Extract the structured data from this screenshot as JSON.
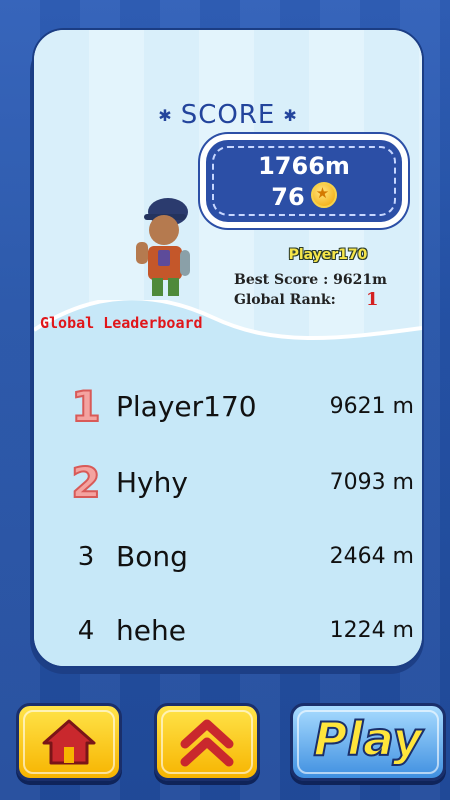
{
  "score_panel": {
    "title": "SCORE",
    "distance": "1766m",
    "coins": "76",
    "player_name": "Player170",
    "best_score": "Best Score : 9621m",
    "global_rank_label": "Global Rank:",
    "global_rank_value": "1"
  },
  "leaderboard": {
    "title": "Global Leaderboard",
    "entries": [
      {
        "rank": "1",
        "name": "Player170",
        "distance": "9621 m"
      },
      {
        "rank": "2",
        "name": "Hyhy",
        "distance": "7093 m"
      },
      {
        "rank": "3",
        "name": "Bong",
        "distance": "2464 m"
      },
      {
        "rank": "4",
        "name": "hehe",
        "distance": "1224 m"
      }
    ]
  },
  "buttons": {
    "home_icon": "home-icon",
    "up_icon": "double-chevron-up-icon",
    "play_label": "Play"
  },
  "colors": {
    "background": "#2553a8",
    "panel": "#dff1fb",
    "score_box": "#2c4fa6",
    "rank_red": "#d42020",
    "button_yellow": "#f7b400"
  }
}
